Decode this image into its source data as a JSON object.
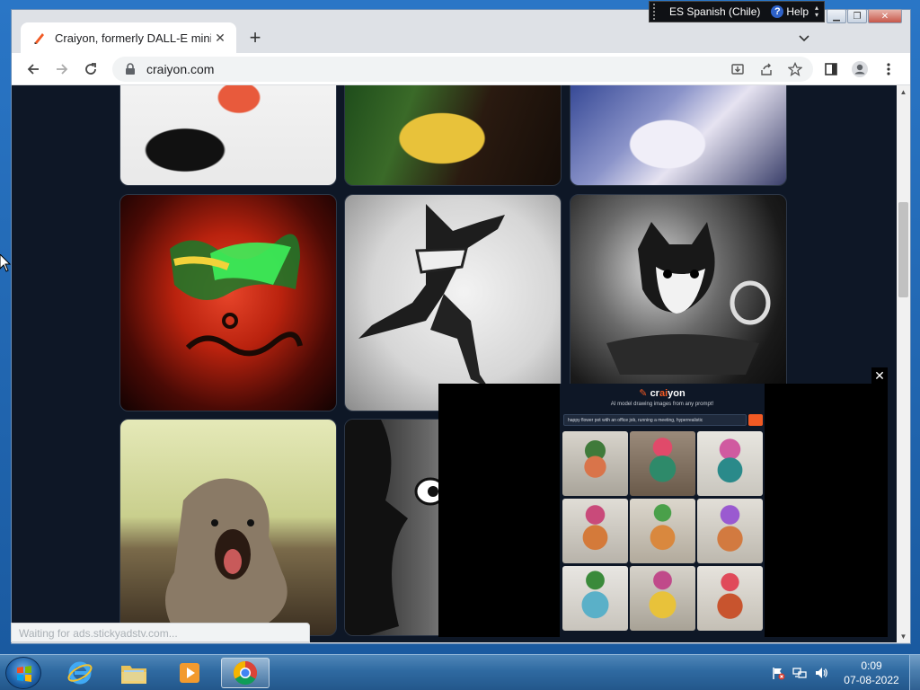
{
  "browser": {
    "tab_title": "Craiyon, formerly DALL-E mini",
    "url": "craiyon.com",
    "status_text": "Waiting for ads.stickyadstv.com..."
  },
  "language_bar": {
    "language": "ES Spanish (Chile)",
    "help_label": "Help"
  },
  "ad": {
    "logo_prefix": "cr",
    "logo_ai": "ai",
    "logo_suffix": "yon",
    "subtitle": "AI model drawing images from any prompt!",
    "prompt": "happy flower pot with an office job, running a meeting, hyperrealistic"
  },
  "taskbar": {
    "time": "0:09",
    "date": "07-08-2022"
  },
  "colors": {
    "page_bg": "#0e1726",
    "accent": "#f15a24"
  }
}
